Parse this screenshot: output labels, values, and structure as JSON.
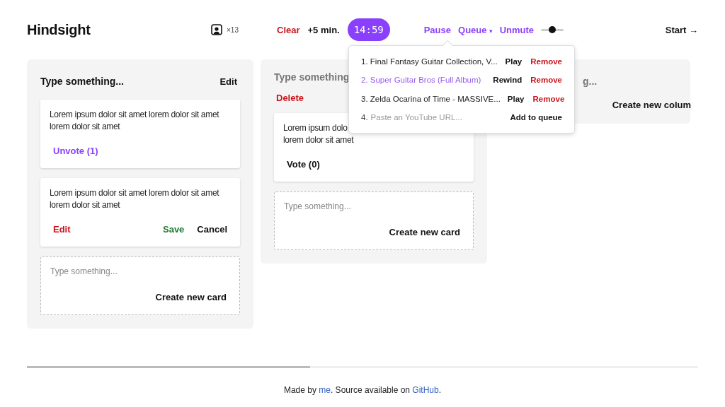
{
  "header": {
    "logo": "Hindsight",
    "participants": "×13",
    "clear": "Clear",
    "add_time": "+5 min.",
    "timer": "14:59",
    "pause": "Pause",
    "queue": "Queue",
    "queue_caret": "▾",
    "mute": "Unmute",
    "volume": {
      "level": 0.5
    },
    "start": "Start →"
  },
  "queue_popup": {
    "items": [
      {
        "number": "1.",
        "title": "Final Fantasy Guitar Collection, V...",
        "selected": false,
        "actions": [
          {
            "kind": "neutral",
            "label": "Play"
          },
          {
            "kind": "danger",
            "label": "Remove"
          }
        ]
      },
      {
        "number": "2.",
        "title": "Super Guitar Bros (Full Album)",
        "selected": true,
        "actions": [
          {
            "kind": "neutral",
            "label": "Rewind"
          },
          {
            "kind": "danger",
            "label": "Remove"
          }
        ]
      },
      {
        "number": "3.",
        "title": "Zelda Ocarina of Time - MASSIVE...",
        "selected": false,
        "actions": [
          {
            "kind": "neutral",
            "label": "Play"
          },
          {
            "kind": "danger",
            "label": "Remove"
          }
        ]
      }
    ],
    "new_item": {
      "number": "4.",
      "placeholder": "Paste an YouTube URL...",
      "button": "Add to queue"
    }
  },
  "columns": [
    {
      "kind": "column",
      "title": "Type something...",
      "title_editing": false,
      "header_action": {
        "kind": "neutral",
        "label": "Edit"
      },
      "cards": [
        {
          "kind": "card",
          "text": [
            "Lorem ipsum dolor sit amet lorem dolor sit amet",
            "lorem dolor sit amet"
          ],
          "vote": "Unvote (1)",
          "voted": true
        },
        {
          "kind": "editing",
          "text": [
            "Lorem ipsum dolor sit amet lorem dolor sit amet",
            "lorem dolor sit amet"
          ],
          "edit": "Edit",
          "save": "Save",
          "cancel": "Cancel"
        },
        {
          "kind": "new",
          "placeholder": "Type something...",
          "button": "Create new card"
        }
      ]
    },
    {
      "kind": "column",
      "title": "Type something",
      "title_editing": true,
      "header_action": {
        "kind": "danger",
        "label": "Delete"
      },
      "cards": [
        {
          "kind": "card",
          "text": [
            "Lorem ipsum dolo",
            "lorem dolor sit amet"
          ],
          "vote": "Vote (0)",
          "voted": false
        },
        {
          "kind": "new",
          "placeholder": "Type something...",
          "button": "Create new card"
        }
      ]
    },
    {
      "kind": "new_column",
      "placeholder": "g...",
      "button": "Create new colum"
    }
  ],
  "footer": {
    "parts": [
      {
        "kind": "text",
        "text": "Made by "
      },
      {
        "kind": "link",
        "text": "me"
      },
      {
        "kind": "text",
        "text": ". Source available on "
      },
      {
        "kind": "link",
        "text": "GitHub"
      },
      {
        "kind": "text",
        "text": "."
      }
    ]
  }
}
